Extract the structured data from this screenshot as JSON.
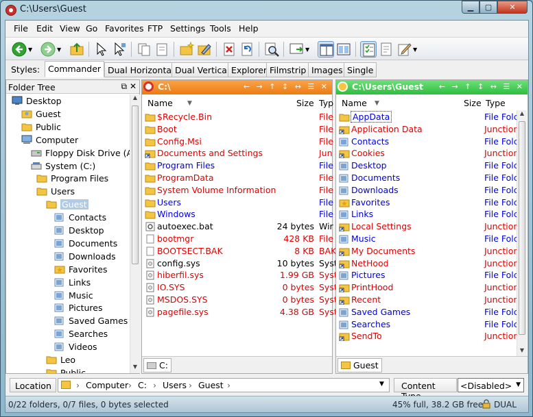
{
  "window": {
    "title": "C:\\Users\\Guest"
  },
  "menu": [
    "File",
    "Edit",
    "View",
    "Go",
    "Favorites",
    "FTP",
    "Settings",
    "Tools",
    "Help"
  ],
  "styles": {
    "label": "Styles:",
    "tabs": [
      "Commander",
      "Dual Horizontal",
      "Dual Vertical",
      "Explorer",
      "Filmstrip",
      "Images",
      "Single"
    ],
    "active": "Commander"
  },
  "folder_tree": {
    "header": "Folder Tree",
    "items": [
      {
        "label": "Desktop",
        "icon": "desktop-icon"
      },
      {
        "label": "Guest",
        "icon": "user-folder-icon"
      },
      {
        "label": "Public",
        "icon": "folder-icon"
      },
      {
        "label": "Computer",
        "icon": "computer-icon"
      },
      {
        "label": "Floppy Disk Drive (A:)",
        "icon": "floppy-icon"
      },
      {
        "label": "System (C:)",
        "icon": "drive-icon"
      },
      {
        "label": "Program Files",
        "icon": "folder-icon"
      },
      {
        "label": "Users",
        "icon": "folder-icon"
      },
      {
        "label": "Guest",
        "icon": "folder-icon",
        "selected": true
      },
      {
        "label": "Contacts",
        "icon": "special-folder-icon"
      },
      {
        "label": "Desktop",
        "icon": "special-folder-icon"
      },
      {
        "label": "Documents",
        "icon": "special-folder-icon"
      },
      {
        "label": "Downloads",
        "icon": "special-folder-icon"
      },
      {
        "label": "Favorites",
        "icon": "favorites-folder-icon"
      },
      {
        "label": "Links",
        "icon": "special-folder-icon"
      },
      {
        "label": "Music",
        "icon": "special-folder-icon"
      },
      {
        "label": "Pictures",
        "icon": "special-folder-icon"
      },
      {
        "label": "Saved Games",
        "icon": "special-folder-icon"
      },
      {
        "label": "Searches",
        "icon": "special-folder-icon"
      },
      {
        "label": "Videos",
        "icon": "special-folder-icon"
      },
      {
        "label": "Leo",
        "icon": "folder-icon"
      },
      {
        "label": "Public",
        "icon": "folder-icon"
      }
    ]
  },
  "left_pane": {
    "title": "C:\\",
    "columns": {
      "name": "Name",
      "size": "Size",
      "type": "Typ"
    },
    "footer_tab": "C:",
    "rows": [
      {
        "name": "$Recycle.Bin",
        "size": "",
        "type": "File",
        "color": "red",
        "icon": "folder-icon"
      },
      {
        "name": "Boot",
        "size": "",
        "type": "File",
        "color": "red",
        "icon": "folder-icon"
      },
      {
        "name": "Config.Msi",
        "size": "",
        "type": "File",
        "color": "red",
        "icon": "folder-icon"
      },
      {
        "name": "Documents and Settings",
        "size": "",
        "type": "Jun",
        "color": "red",
        "icon": "shortcut-folder-icon"
      },
      {
        "name": "Program Files",
        "size": "",
        "type": "File",
        "color": "blue",
        "icon": "folder-icon"
      },
      {
        "name": "ProgramData",
        "size": "",
        "type": "File",
        "color": "red",
        "icon": "folder-icon"
      },
      {
        "name": "System Volume Information",
        "size": "",
        "type": "File",
        "color": "red",
        "icon": "folder-icon"
      },
      {
        "name": "Users",
        "size": "",
        "type": "File",
        "color": "blue",
        "icon": "folder-icon"
      },
      {
        "name": "Windows",
        "size": "",
        "type": "File",
        "color": "blue",
        "icon": "folder-icon"
      },
      {
        "name": "autoexec.bat",
        "size": "24 bytes",
        "type": "Wir",
        "color": "black",
        "icon": "bat-file-icon"
      },
      {
        "name": "bootmgr",
        "size": "428 KB",
        "type": "File",
        "color": "red",
        "icon": "file-icon"
      },
      {
        "name": "BOOTSECT.BAK",
        "size": "8 KB",
        "type": "BAK",
        "color": "red",
        "icon": "file-icon"
      },
      {
        "name": "config.sys",
        "size": "10 bytes",
        "type": "Syst",
        "color": "black",
        "icon": "sys-file-icon"
      },
      {
        "name": "hiberfil.sys",
        "size": "1.99 GB",
        "type": "Syst",
        "color": "red",
        "icon": "sys-file-icon"
      },
      {
        "name": "IO.SYS",
        "size": "0 bytes",
        "type": "Syst",
        "color": "red",
        "icon": "sys-file-icon"
      },
      {
        "name": "MSDOS.SYS",
        "size": "0 bytes",
        "type": "Syst",
        "color": "red",
        "icon": "sys-file-icon"
      },
      {
        "name": "pagefile.sys",
        "size": "4.38 GB",
        "type": "Syst",
        "color": "red",
        "icon": "sys-file-icon"
      }
    ]
  },
  "right_pane": {
    "title": "C:\\Users\\Guest",
    "columns": {
      "name": "Name",
      "size": "Size",
      "type": "Type"
    },
    "footer_tab": "Guest",
    "rows": [
      {
        "name": "AppData",
        "type": "File Folc",
        "color": "blue",
        "icon": "folder-icon",
        "focused": true
      },
      {
        "name": "Application Data",
        "type": "Junction",
        "color": "red",
        "icon": "shortcut-folder-icon"
      },
      {
        "name": "Contacts",
        "type": "File Folc",
        "color": "blue",
        "icon": "special-folder-icon"
      },
      {
        "name": "Cookies",
        "type": "Junction",
        "color": "red",
        "icon": "shortcut-folder-icon"
      },
      {
        "name": "Desktop",
        "type": "File Folc",
        "color": "blue",
        "icon": "special-folder-icon"
      },
      {
        "name": "Documents",
        "type": "File Folc",
        "color": "blue",
        "icon": "special-folder-icon"
      },
      {
        "name": "Downloads",
        "type": "File Folc",
        "color": "blue",
        "icon": "special-folder-icon"
      },
      {
        "name": "Favorites",
        "type": "File Folc",
        "color": "blue",
        "icon": "favorites-folder-icon"
      },
      {
        "name": "Links",
        "type": "File Folc",
        "color": "blue",
        "icon": "special-folder-icon"
      },
      {
        "name": "Local Settings",
        "type": "Junction",
        "color": "red",
        "icon": "shortcut-folder-icon"
      },
      {
        "name": "Music",
        "type": "File Folc",
        "color": "blue",
        "icon": "special-folder-icon"
      },
      {
        "name": "My Documents",
        "type": "Junction",
        "color": "red",
        "icon": "shortcut-folder-icon"
      },
      {
        "name": "NetHood",
        "type": "Junction",
        "color": "red",
        "icon": "shortcut-folder-icon"
      },
      {
        "name": "Pictures",
        "type": "File Folc",
        "color": "blue",
        "icon": "special-folder-icon"
      },
      {
        "name": "PrintHood",
        "type": "Junction",
        "color": "red",
        "icon": "shortcut-folder-icon"
      },
      {
        "name": "Recent",
        "type": "Junction",
        "color": "red",
        "icon": "shortcut-folder-icon"
      },
      {
        "name": "Saved Games",
        "type": "File Folc",
        "color": "blue",
        "icon": "special-folder-icon"
      },
      {
        "name": "Searches",
        "type": "File Folc",
        "color": "blue",
        "icon": "special-folder-icon"
      },
      {
        "name": "SendTo",
        "type": "Junction",
        "color": "red",
        "icon": "shortcut-folder-icon"
      }
    ]
  },
  "location": {
    "label": "Location",
    "crumbs": [
      "Computer",
      "C:",
      "Users",
      "Guest"
    ]
  },
  "content_type": {
    "label": "Content Type",
    "value": "<Disabled>"
  },
  "status": {
    "left": "0/22 folders, 0/7 files, 0 bytes selected",
    "right": "45% full, 38.2 GB free",
    "mode": "DUAL"
  },
  "colors": {
    "left_title": "#f08a1c",
    "right_title": "#3dc94c",
    "hidden_text": "#e00000",
    "normal_text": "#0000e0"
  }
}
